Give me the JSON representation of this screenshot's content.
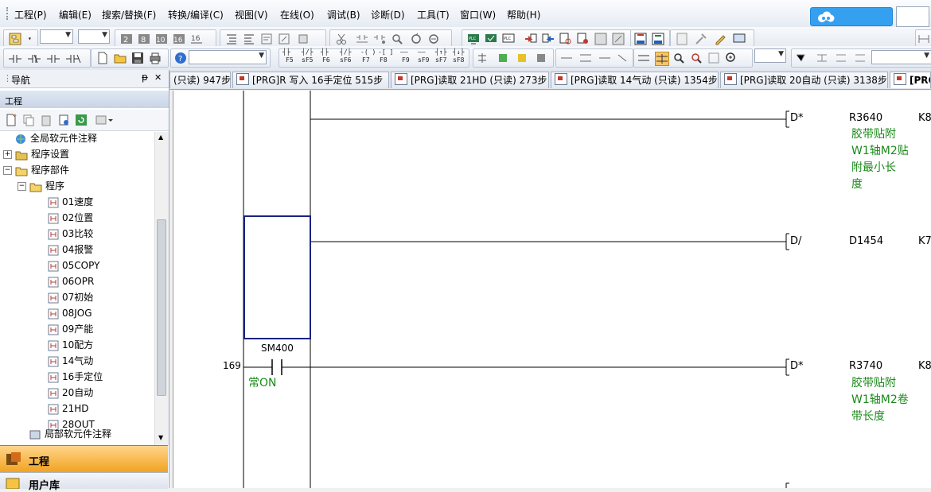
{
  "menu": {
    "items": [
      "工程(P)",
      "编辑(E)",
      "搜索/替换(F)",
      "转换/编译(C)",
      "视图(V)",
      "在线(O)",
      "调试(B)",
      "诊断(D)",
      "工具(T)",
      "窗口(W)",
      "帮助(H)"
    ]
  },
  "toolbar": {
    "fkeys": [
      "F5",
      "sF5",
      "F6",
      "sF6",
      "F7",
      "F8",
      "F9",
      "sF9",
      "sF7",
      "sF8"
    ]
  },
  "nav": {
    "title": "导航",
    "pin": "ᵖ",
    "close": "✕",
    "project_label": "工程",
    "tree": {
      "global_comment": "全局软元件注释",
      "program_settings": "程序设置",
      "program_parts": "程序部件",
      "program": "程序",
      "programs": [
        "01速度",
        "02位置",
        "03比较",
        "04报警",
        "05COPY",
        "06OPR",
        "07初始",
        "08JOG",
        "09产能",
        "10配方",
        "14气动",
        "16手定位",
        "20自动",
        "21HD",
        "28OUT"
      ],
      "local_comment": "局部软元件注释"
    },
    "bottom_tabs": {
      "project": "工程",
      "user_lib": "用户库"
    }
  },
  "tabs": [
    {
      "label": "(只读) 947步"
    },
    {
      "label": "[PRG]R 写入 16手定位 515步"
    },
    {
      "label": "[PRG]读取 21HD (只读) 273步"
    },
    {
      "label": "[PRG]读取 14气动 (只读) 1354步"
    },
    {
      "label": "[PRG]读取 20自动 (只读) 3138步"
    },
    {
      "label": "[PRG"
    }
  ],
  "ladder": {
    "rows": [
      {
        "instr": "D*",
        "op1": "R3640",
        "op2": "K8",
        "comment": [
          "胶带贴附",
          "W1轴M2贴",
          "附最小长",
          "度"
        ]
      },
      {
        "instr": "D/",
        "op1": "D1454",
        "op2": "K7",
        "comment": []
      },
      {
        "step": "169",
        "contact": "SM400",
        "contact_comment": "常ON",
        "instr": "D*",
        "op1": "R3740",
        "op2": "K8",
        "comment": [
          "胶带贴附",
          "W1轴M2卷",
          "带长度"
        ]
      }
    ]
  }
}
